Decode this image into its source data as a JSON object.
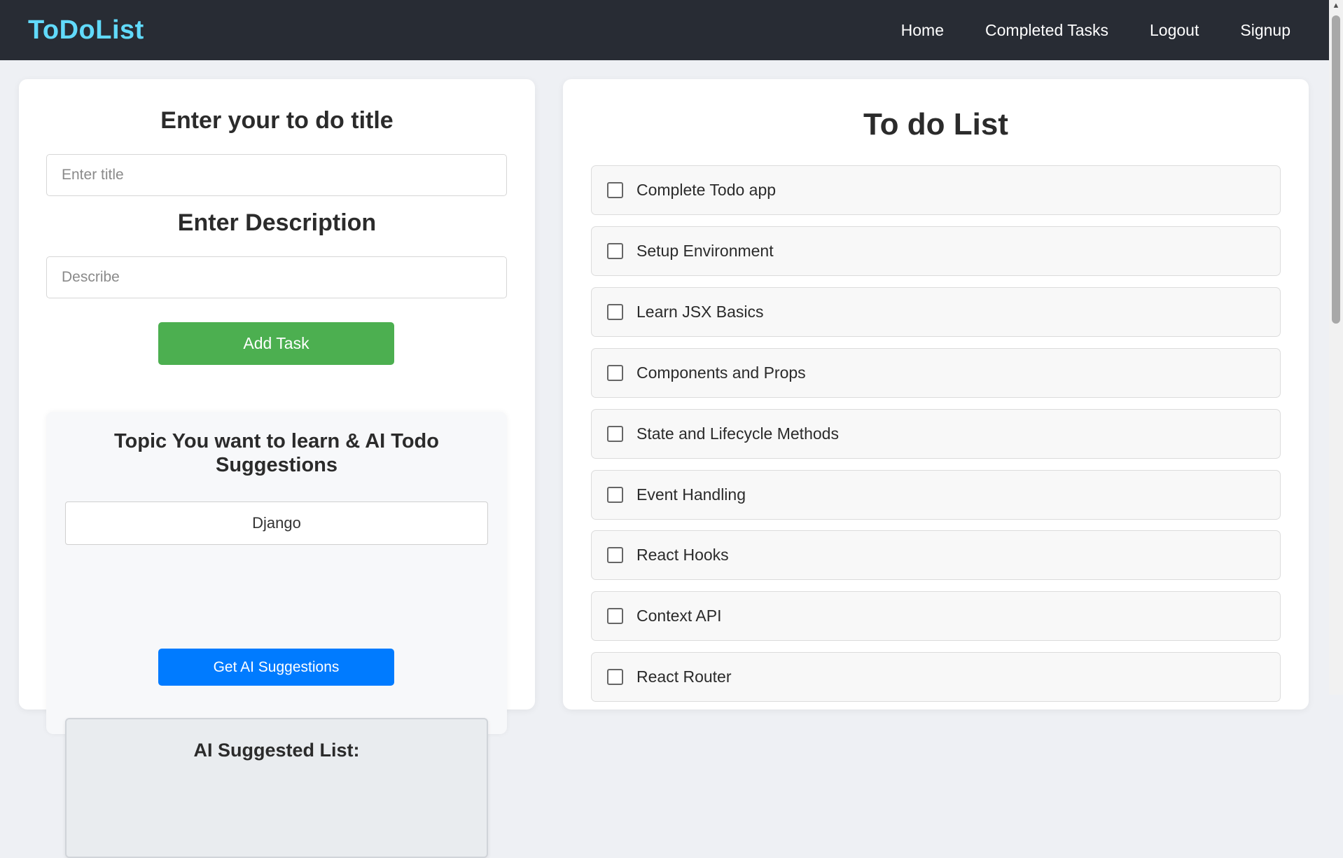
{
  "navbar": {
    "brand": "ToDoList",
    "links": [
      "Home",
      "Completed Tasks",
      "Logout",
      "Signup"
    ]
  },
  "form": {
    "title_heading": "Enter your to do title",
    "title_placeholder": "Enter title",
    "title_value": "",
    "desc_heading": "Enter Description",
    "desc_placeholder": "Describe",
    "desc_value": "",
    "add_button": "Add Task"
  },
  "ai": {
    "heading": "Topic You want to learn & AI Todo Suggestions",
    "topic_value": "Django",
    "button": "Get AI Suggestions",
    "list_title": "AI Suggested List:"
  },
  "todo": {
    "heading": "To do List",
    "items": [
      {
        "label": "Complete Todo app",
        "checked": false
      },
      {
        "label": "Setup Environment",
        "checked": false
      },
      {
        "label": "Learn JSX Basics",
        "checked": false
      },
      {
        "label": "Components and Props",
        "checked": false
      },
      {
        "label": "State and Lifecycle Methods",
        "checked": false
      },
      {
        "label": "Event Handling",
        "checked": false
      },
      {
        "label": "React Hooks",
        "checked": false
      },
      {
        "label": "Context API",
        "checked": false
      },
      {
        "label": "React Router",
        "checked": false
      }
    ]
  },
  "colors": {
    "navbar_bg": "#282c34",
    "brand": "#61dafb",
    "add_button": "#4caf50",
    "ai_button": "#007bff"
  }
}
